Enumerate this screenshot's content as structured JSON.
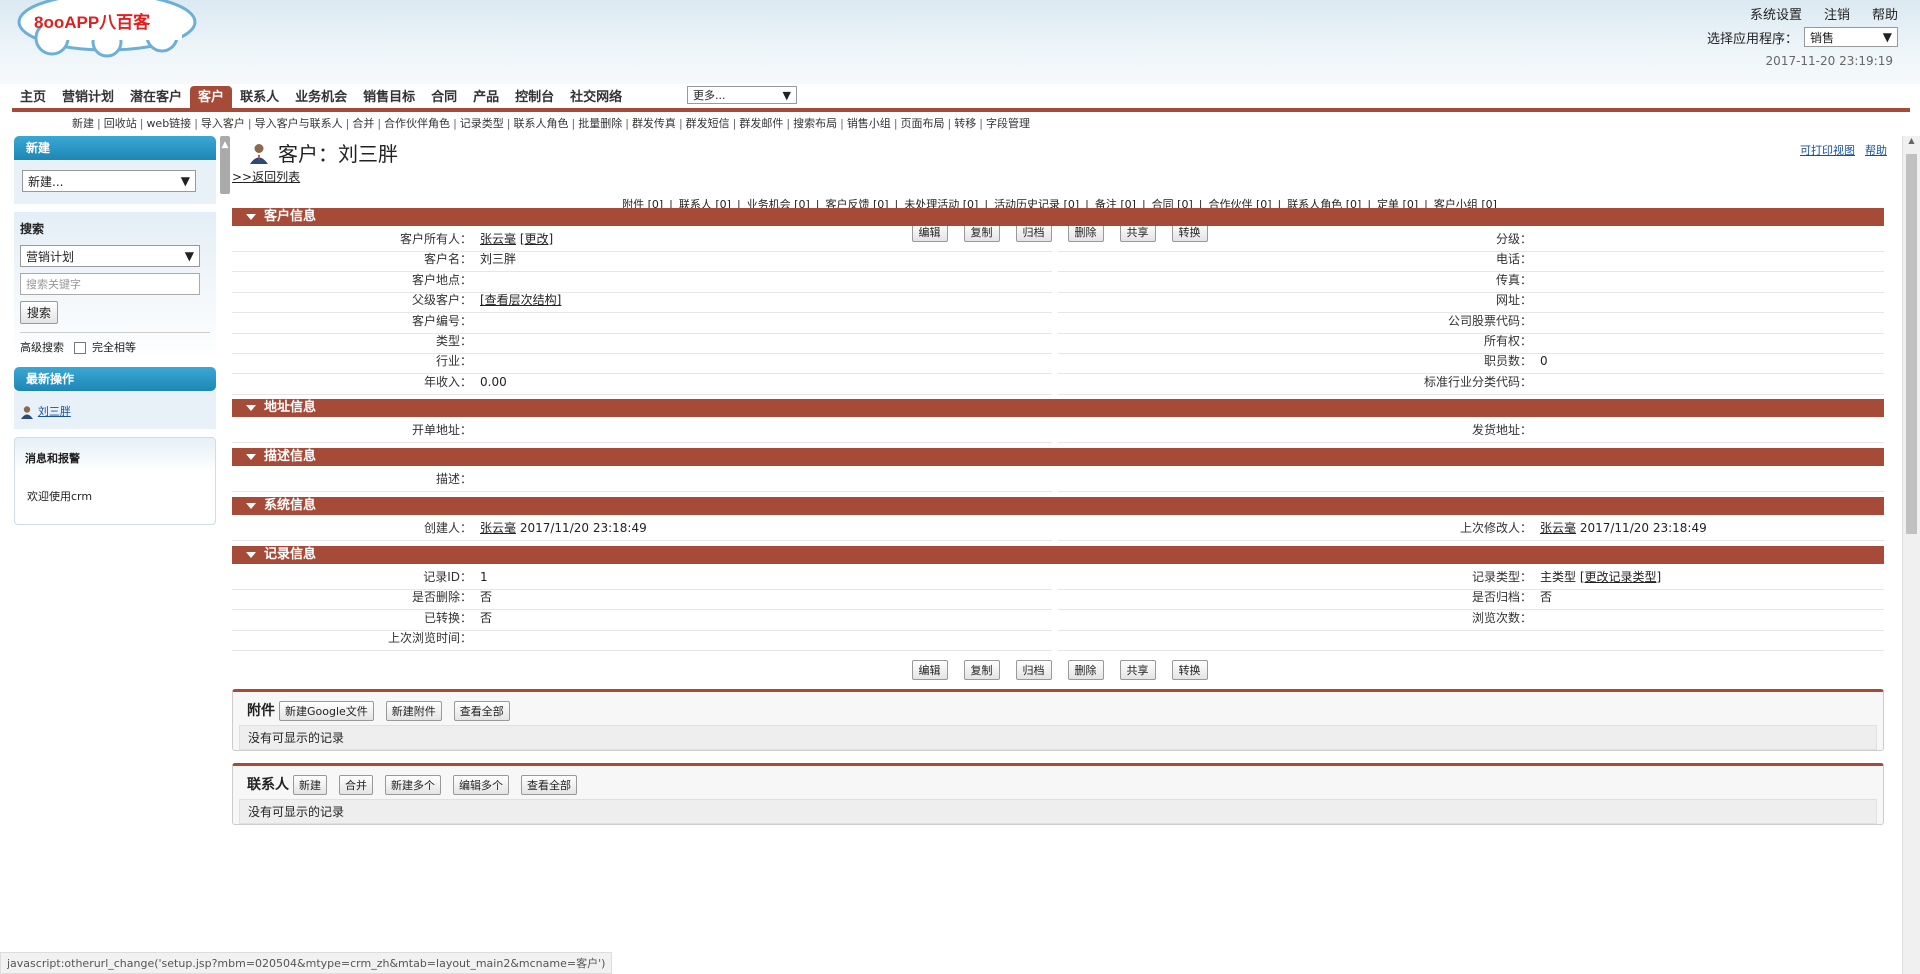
{
  "header": {
    "logo_text": "8ooAPP八百客",
    "links": [
      "系统设置",
      "注销",
      "帮助"
    ],
    "app_select_label": "选择应用程序：",
    "app_select_value": "销售",
    "datetime": "2017-11-20 23:19:19"
  },
  "tabs": [
    {
      "label": "主页"
    },
    {
      "label": "营销计划"
    },
    {
      "label": "潜在客户"
    },
    {
      "label": "客户",
      "active": true
    },
    {
      "label": "联系人"
    },
    {
      "label": "业务机会"
    },
    {
      "label": "销售目标"
    },
    {
      "label": "合同"
    },
    {
      "label": "产品"
    },
    {
      "label": "控制台"
    },
    {
      "label": "社交网络"
    }
  ],
  "more_select": "更多...",
  "subnav": [
    "新建",
    "回收站",
    "web链接",
    "导入客户",
    "导入客户与联系人",
    "合并",
    "合作伙伴角色",
    "记录类型",
    "联系人角色",
    "批量删除",
    "群发传真",
    "群发短信",
    "群发邮件",
    "搜索布局",
    "销售小组",
    "页面布局",
    "转移",
    "字段管理"
  ],
  "sidebar": {
    "new_title": "新建",
    "new_select": "新建...",
    "search_title": "搜索",
    "search_select": "营销计划",
    "search_placeholder": "搜索关键字",
    "search_button": "搜索",
    "advanced_search": "高级搜索",
    "exact_match": "完全相等",
    "recent_title": "最新操作",
    "recent_item": "刘三胖",
    "messages_title": "消息和报警",
    "messages_text": "欢迎使用crm"
  },
  "main": {
    "title": "客户：刘三胖",
    "back_link": ">>返回列表",
    "printable": "可打印视图",
    "help": "帮助",
    "related_links": [
      "附件 [0]",
      "联系人 [0]",
      "业务机会 [0]",
      "客户反馈 [0]",
      "未处理活动 [0]",
      "活动历史记录 [0]",
      "备注 [0]",
      "合同 [0]",
      "合作伙伴 [0]",
      "联系人角色 [0]",
      "定单 [0]",
      "客户小组 [0]"
    ],
    "buttons": [
      "编辑",
      "复制",
      "归档",
      "删除",
      "共享",
      "转换"
    ],
    "sections": {
      "customer_info": "客户信息",
      "address_info": "地址信息",
      "description_info": "描述信息",
      "system_info": "系统信息",
      "record_info": "记录信息"
    },
    "customer_fields": [
      {
        "l1": "客户所有人：",
        "v1": "张云毫",
        "v1_extra": "[更改]",
        "l2": "分级：",
        "v2": ""
      },
      {
        "l1": "客户名：",
        "v1": "刘三胖",
        "l2": "电话：",
        "v2": ""
      },
      {
        "l1": "客户地点：",
        "v1": "",
        "l2": "传真：",
        "v2": ""
      },
      {
        "l1": "父级客户：",
        "v1": "",
        "v1_extra": "[查看层次结构]",
        "l2": "网址：",
        "v2": ""
      },
      {
        "l1": "客户编号：",
        "v1": "",
        "l2": "公司股票代码：",
        "v2": ""
      },
      {
        "l1": "类型：",
        "v1": "",
        "l2": "所有权：",
        "v2": ""
      },
      {
        "l1": "行业：",
        "v1": "",
        "l2": "职员数：",
        "v2": "0"
      },
      {
        "l1": "年收入：",
        "v1": "0.00",
        "l2": "标准行业分类代码：",
        "v2": ""
      }
    ],
    "address_fields": [
      {
        "l1": "开单地址：",
        "v1": "",
        "l2": "发货地址：",
        "v2": ""
      }
    ],
    "description_fields": [
      {
        "l1": "描述：",
        "v1": ""
      }
    ],
    "system_fields": [
      {
        "l1": "创建人：",
        "v1": "张云毫",
        "v1_extra": "2017/11/20 23:18:49",
        "l2": "上次修改人：",
        "v2": "张云毫",
        "v2_extra": "2017/11/20 23:18:49"
      }
    ],
    "record_fields": [
      {
        "l1": "记录ID：",
        "v1": "1",
        "l2": "记录类型：",
        "v2": "主类型",
        "v2_extra": "[更改记录类型]"
      },
      {
        "l1": "是否删除：",
        "v1": "否",
        "l2": "是否归档：",
        "v2": "否"
      },
      {
        "l1": "已转换：",
        "v1": "否",
        "l2": "浏览次数：",
        "v2": ""
      },
      {
        "l1": "上次浏览时间：",
        "v1": ""
      }
    ],
    "attachments": {
      "title": "附件",
      "buttons": [
        "新建Google文件",
        "新建附件",
        "查看全部"
      ],
      "empty": "没有可显示的记录"
    },
    "contacts": {
      "title": "联系人",
      "buttons": [
        "新建",
        "合并",
        "新建多个",
        "编辑多个",
        "查看全部"
      ],
      "empty": "没有可显示的记录"
    }
  },
  "status_bar": "javascript:otherurl_change('setup.jsp?mbm=020504&mtype=crm_zh&mtab=layout_main2&mcname=客户')",
  "colors": {
    "accent": "#a74b39",
    "sidebar_head": "#1e86b6"
  }
}
